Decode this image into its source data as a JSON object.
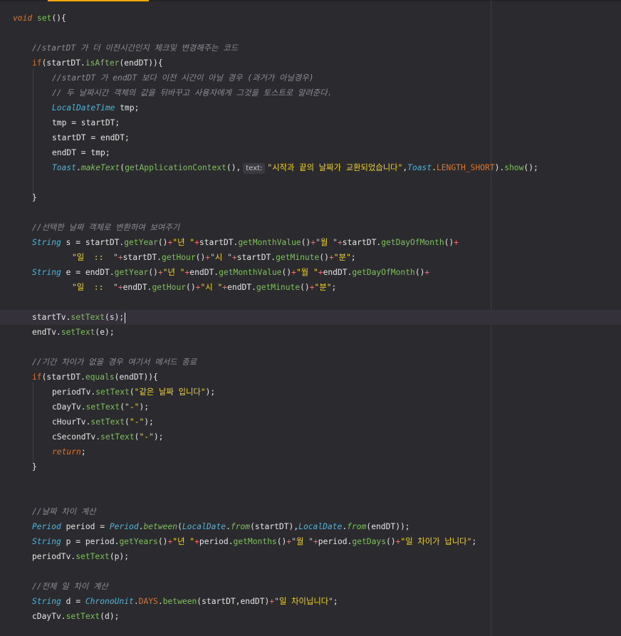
{
  "editor": {
    "lines": {
      "l1": {
        "a": "void",
        "b": " ",
        "c": "set",
        "d": "(){"
      },
      "l3": {
        "c": "//startDT 가 더 이전시간인지 체크및 변경해주는 코드"
      },
      "l4": {
        "a": "if",
        "b": "(startDT.",
        "c": "isAfter",
        "d": "(endDT)){"
      },
      "l5": {
        "c": "//startDT 가 endDT 보다 이전 시간이 아닐 경우 (과거가 아닐경우)"
      },
      "l6": {
        "c": "// 두 날짜시간 객체의 값을 뒤바꾸고 사용자에게 그것을 토스트로 알려준다."
      },
      "l7": {
        "a": "LocalDateTime",
        "b": " tmp;"
      },
      "l8": {
        "a": "tmp = startDT;"
      },
      "l9": {
        "a": "startDT = endDT;"
      },
      "l10": {
        "a": "endDT = tmp;"
      },
      "l11": {
        "a": "Toast",
        "b": ".",
        "c": "makeText",
        "d": "(",
        "e": "getApplicationContext",
        "f": "(),",
        "hint": "text:",
        "g": "\"시작과 끝의 날짜가 교환되었습니다\"",
        "h": ",",
        "i": "Toast",
        "j": ".",
        "k": "LENGTH_SHORT",
        "l": ").",
        "m": "show",
        "n": "();"
      },
      "l13": {
        "a": "}"
      },
      "l15": {
        "c": "//선택한 날짜 객체로 변환하여 보여주기"
      },
      "l16": {
        "a": "String",
        "b": " s = startDT.",
        "c": "getYear",
        "d": "()",
        "e": "+",
        "f": "\"년 \"",
        "g": "+",
        "h": "startDT.",
        "i": "getMonthValue",
        "j": "()",
        "k": "+",
        "l": "\"월 \"",
        "m": "+",
        "n": "startDT.",
        "o": "getDayOfMonth",
        "p": "()",
        "q": "+"
      },
      "l17": {
        "a": "\"일  ::  \"",
        "b": "+",
        "c": "startDT.",
        "d": "getHour",
        "e": "()",
        "f": "+",
        "g": "\"시 \"",
        "h": "+",
        "i": "startDT.",
        "j": "getMinute",
        "k": "()",
        "l": "+",
        "m": "\"분\"",
        "n": ";"
      },
      "l18": {
        "a": "String",
        "b": " e = endDT.",
        "c": "getYear",
        "d": "()",
        "e": "+",
        "f": "\"년 \"",
        "g": "+",
        "h": "endDT.",
        "i": "getMonthValue",
        "j": "()",
        "k": "+",
        "l": "\"월 \"",
        "m": "+",
        "n": "endDT.",
        "o": "getDayOfMonth",
        "p": "()",
        "q": "+"
      },
      "l19": {
        "a": "\"일  ::  \"",
        "b": "+",
        "c": "endDT.",
        "d": "getHour",
        "e": "()",
        "f": "+",
        "g": "\"시 \"",
        "h": "+",
        "i": "endDT.",
        "j": "getMinute",
        "k": "()",
        "l": "+",
        "m": "\"분\"",
        "n": ";"
      },
      "l21": {
        "a": "startTv.",
        "b": "setText",
        "c": "(s);"
      },
      "l22": {
        "a": "endTv.",
        "b": "setText",
        "c": "(e);"
      },
      "l24": {
        "c": "//기간 차이가 없을 경우 여기서 메서드 종료"
      },
      "l25": {
        "a": "if",
        "b": "(startDT.",
        "c": "equals",
        "d": "(endDT)){"
      },
      "l26": {
        "a": "periodTv.",
        "b": "setText",
        "c": "(",
        "d": "\"같은 날짜 입니다\"",
        "e": ");"
      },
      "l27": {
        "a": "cDayTv.",
        "b": "setText",
        "c": "(",
        "d": "\"-\"",
        "e": ");"
      },
      "l28": {
        "a": "cHourTv.",
        "b": "setText",
        "c": "(",
        "d": "\"-\"",
        "e": ");"
      },
      "l29": {
        "a": "cSecondTv.",
        "b": "setText",
        "c": "(",
        "d": "\"-\"",
        "e": ");"
      },
      "l30": {
        "a": "return",
        "b": ";"
      },
      "l31": {
        "a": "}"
      },
      "l34": {
        "c": "//날짜 차이 계산"
      },
      "l35": {
        "a": "Period",
        "b": " period = ",
        "c": "Period",
        "d": ".",
        "e": "between",
        "f": "(",
        "g": "LocalDate",
        "h": ".",
        "i": "from",
        "j": "(startDT),",
        "k": "LocalDate",
        "l": ".",
        "m": "from",
        "n": "(endDT));"
      },
      "l36": {
        "a": "String",
        "b": " p = period.",
        "c": "getYears",
        "d": "()",
        "e": "+",
        "f": "\"년 \"",
        "g": "+",
        "h": "period.",
        "i": "getMonths",
        "j": "()",
        "k": "+",
        "l": "\"월 \"",
        "m": "+",
        "n": "period.",
        "o": "getDays",
        "p": "()",
        "q": "+",
        "r": "\"일 차이가 납니다\"",
        "s": ";"
      },
      "l37": {
        "a": "periodTv.",
        "b": "setText",
        "c": "(p);"
      },
      "l39": {
        "c": "//전체 일 차이 계산"
      },
      "l40": {
        "a": "String",
        "b": " d = ",
        "c": "ChronoUnit",
        "d": ".",
        "e": "DAYS",
        "f": ".",
        "g": "between",
        "h": "(startDT,endDT)",
        "i": "+",
        "j": "\"일 차이닙니다\"",
        "k": ";"
      },
      "l41": {
        "a": "cDayTv.",
        "b": "setText",
        "c": "(d);"
      }
    }
  }
}
